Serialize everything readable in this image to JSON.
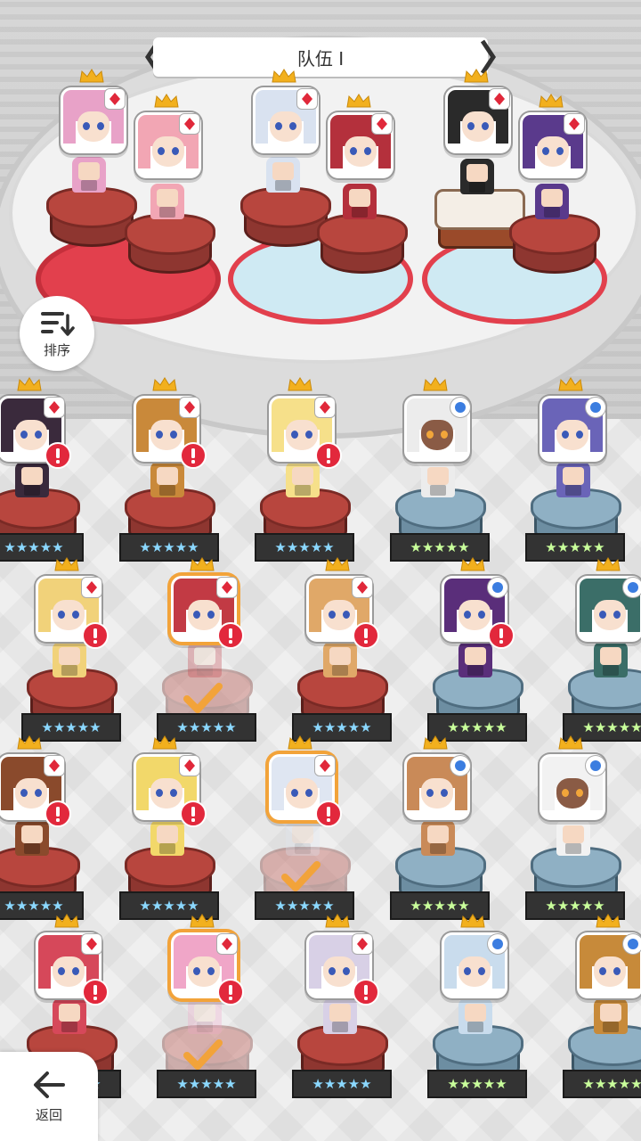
{
  "header": {
    "team_title": "队伍 I",
    "prev_icon": "chevron-left-icon",
    "next_icon": "chevron-right-icon"
  },
  "controls": {
    "sort_label": "排序",
    "sort_icon": "sort-icon",
    "back_label": "返回",
    "back_icon": "arrow-left-icon"
  },
  "colors": {
    "crown": "#f2b01e",
    "alert": "#e2283c",
    "selected_frame": "#f2a33a",
    "check": "#f2a33a",
    "red_pedestal": "#b8463e",
    "blue_pedestal": "#8fb0c4"
  },
  "team": [
    {
      "slot": 1,
      "hair": "#e8a2c8",
      "class": "red",
      "crown": true
    },
    {
      "slot": 2,
      "hair": "#f2a6b4",
      "class": "red",
      "crown": true
    },
    {
      "slot": 3,
      "hair": "#d9e2f0",
      "class": "red",
      "crown": true
    },
    {
      "slot": 4,
      "hair": "#b4303c",
      "class": "red",
      "crown": true
    },
    {
      "slot": 5,
      "hair": "#2a2a2a",
      "class": "red",
      "crown": true
    },
    {
      "slot": 6,
      "hair": "#5a3a8c",
      "class": "red",
      "crown": true
    }
  ],
  "roster_rows": [
    [
      {
        "hair": "#3a2a3c",
        "badge": "card",
        "alert": true,
        "pedestal": "red"
      },
      {
        "hair": "#c9893a",
        "badge": "card",
        "alert": true,
        "pedestal": "red"
      },
      {
        "hair": "#f6e08a",
        "badge": "card",
        "alert": true,
        "pedestal": "red"
      },
      {
        "hair": "#ececec",
        "badge": "dot",
        "alert": false,
        "pedestal": "blue",
        "dark": true
      },
      {
        "hair": "#6a64b8",
        "badge": "dot",
        "alert": false,
        "pedestal": "blue"
      }
    ],
    [
      {
        "hair": "#f1d27a",
        "badge": "card",
        "alert": true,
        "pedestal": "red"
      },
      {
        "hair": "#c23a44",
        "badge": "card",
        "alert": true,
        "pedestal": "red",
        "selected": true
      },
      {
        "hair": "#e0a868",
        "badge": "card",
        "alert": true,
        "pedestal": "red"
      },
      {
        "hair": "#5a2e7a",
        "badge": "dot",
        "alert": true,
        "pedestal": "blue"
      },
      {
        "hair": "#3b6e68",
        "badge": "dot",
        "alert": false,
        "pedestal": "blue"
      }
    ],
    [
      {
        "hair": "#8a4a2c",
        "badge": "card",
        "alert": true,
        "pedestal": "red"
      },
      {
        "hair": "#f2d86a",
        "badge": "card",
        "alert": true,
        "pedestal": "red"
      },
      {
        "hair": "#dfe6f2",
        "badge": "card",
        "alert": true,
        "pedestal": "red",
        "selected": true
      },
      {
        "hair": "#c98a58",
        "badge": "dot",
        "alert": false,
        "pedestal": "blue"
      },
      {
        "hair": "#f2f2f2",
        "badge": "dot",
        "alert": false,
        "pedestal": "blue",
        "dark": true
      }
    ],
    [
      {
        "hair": "#d6485a",
        "badge": "card",
        "alert": true,
        "pedestal": "red"
      },
      {
        "hair": "#f0a6c8",
        "badge": "card",
        "alert": true,
        "pedestal": "red",
        "selected": true
      },
      {
        "hair": "#d8d0e6",
        "badge": "card",
        "alert": true,
        "pedestal": "red"
      },
      {
        "hair": "#c9dced",
        "badge": "dot",
        "alert": false,
        "pedestal": "blue"
      },
      {
        "hair": "#c78a3a",
        "badge": "dot",
        "alert": false,
        "pedestal": "blue"
      }
    ]
  ],
  "star_rating": "★★★★★"
}
